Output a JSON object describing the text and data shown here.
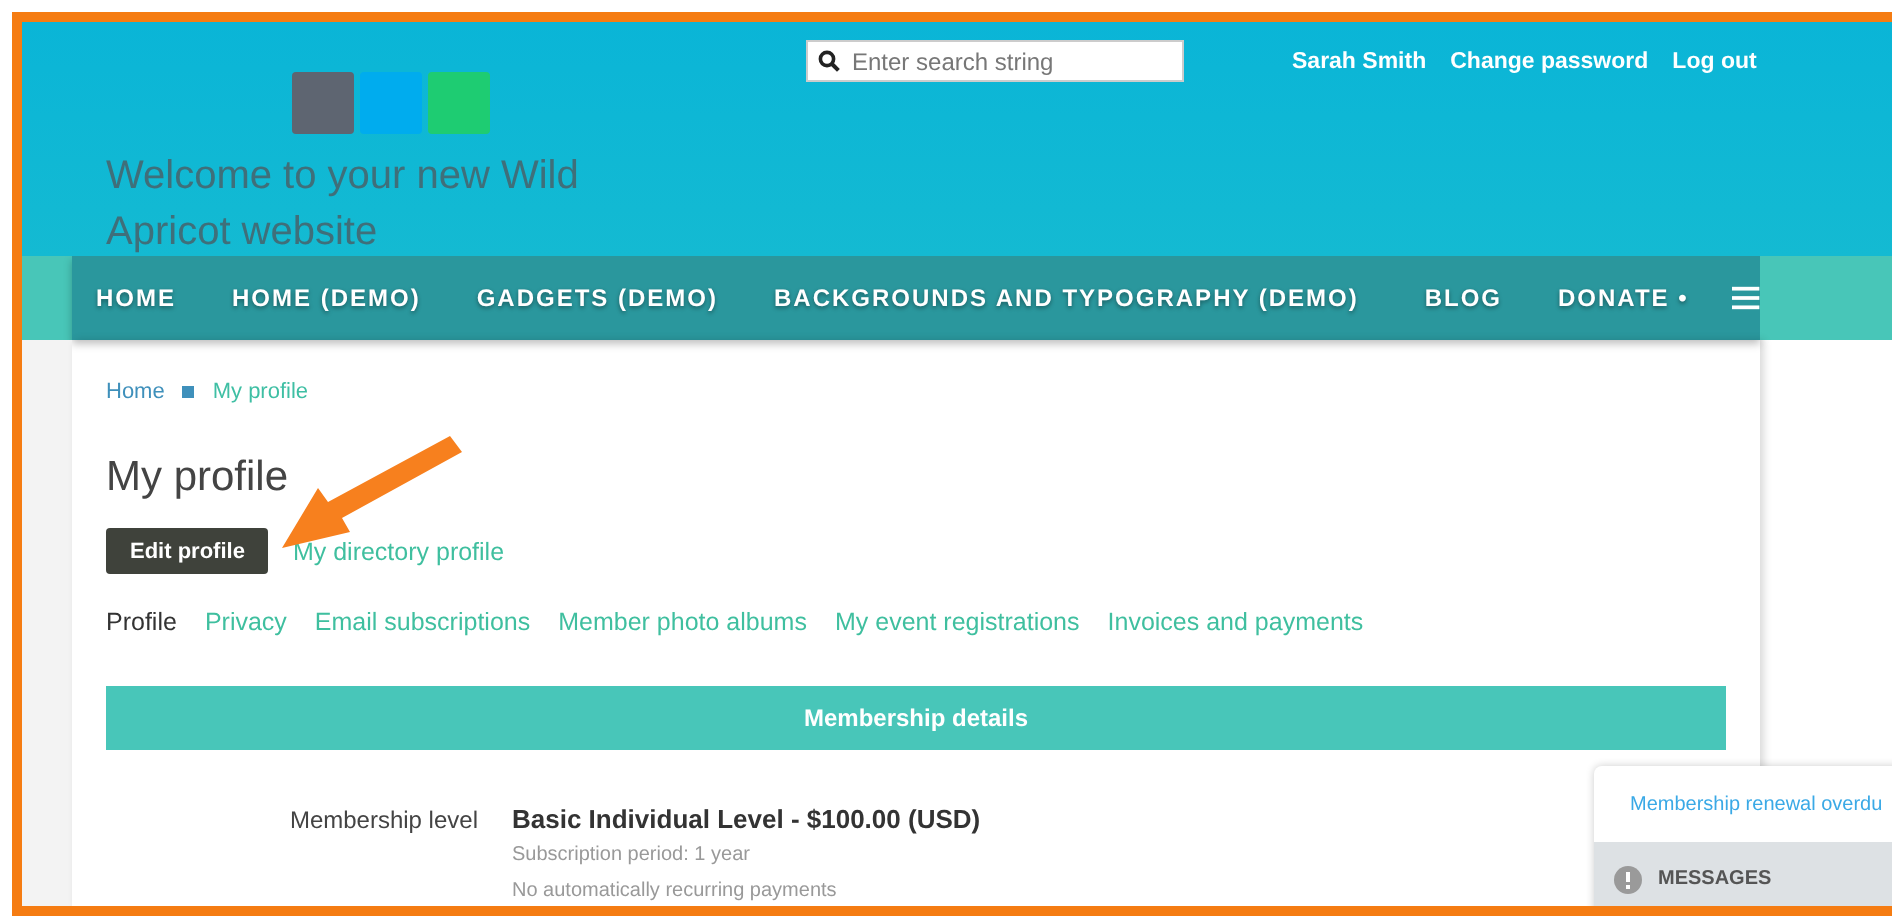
{
  "header": {
    "title": "Welcome to your new Wild Apricot website",
    "search": {
      "placeholder": "Enter search string"
    },
    "user_links": [
      "Sarah Smith",
      "Change password",
      "Log out"
    ]
  },
  "nav": {
    "items": [
      "HOME",
      "HOME (DEMO)",
      "GADGETS (DEMO)",
      "BACKGROUNDS AND TYPOGRAPHY (DEMO)",
      "BLOG",
      "DONATE •"
    ]
  },
  "breadcrumb": [
    {
      "label": "Home",
      "current": false
    },
    {
      "label": "My profile",
      "current": true
    }
  ],
  "page_title": "My profile",
  "actions": {
    "button": "Edit profile",
    "link": "My directory profile"
  },
  "tabs": [
    {
      "label": "Profile",
      "selected": true
    },
    {
      "label": "Privacy",
      "selected": false
    },
    {
      "label": "Email subscriptions",
      "selected": false
    },
    {
      "label": "Member photo albums",
      "selected": false
    },
    {
      "label": "My event registrations",
      "selected": false
    },
    {
      "label": "Invoices and payments",
      "selected": false
    }
  ],
  "membership": {
    "heading": "Membership details",
    "rows": [
      {
        "label": "Membership level",
        "value": "Basic Individual Level - $100.00 (USD)",
        "notes": [
          "Subscription period: 1 year",
          "No automatically recurring payments"
        ]
      }
    ]
  },
  "messages": {
    "notice": "Membership renewal overdu",
    "title": "MESSAGES"
  }
}
